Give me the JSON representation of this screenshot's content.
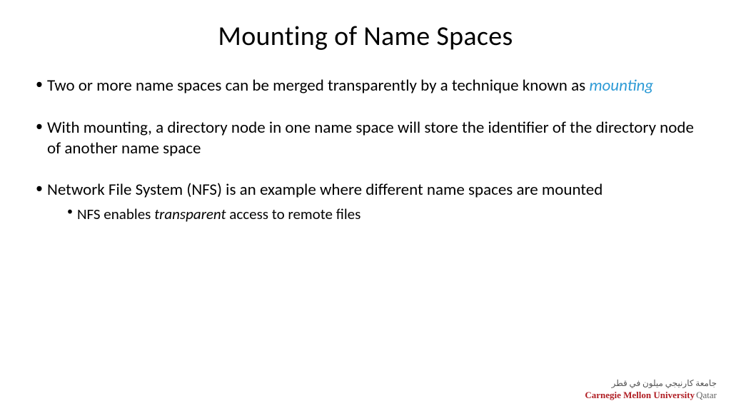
{
  "title": "Mounting of Name Spaces",
  "bullets": {
    "b1_pre": "Two or more name spaces can be merged transparently by a technique known as ",
    "b1_highlight": "mounting",
    "b2": "With mounting, a directory node in one name space will store the identifier of the directory node of another name space",
    "b3": "Network File System (NFS) is an example where different name spaces are mounted",
    "b3_sub_pre": "NFS enables ",
    "b3_sub_italic": "transparent",
    "b3_sub_post": " access to remote files"
  },
  "footer": {
    "arabic": "جامعة كارنيجي میلون في قطر",
    "university": "Carnegie Mellon University",
    "location": "Qatar"
  }
}
